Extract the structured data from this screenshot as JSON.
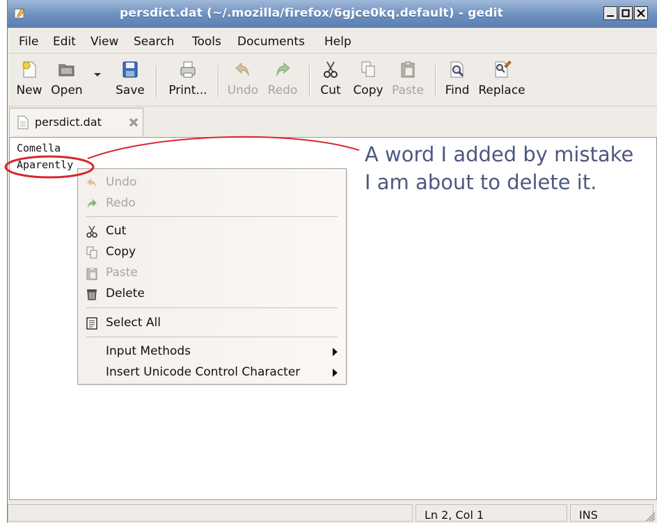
{
  "window": {
    "title": "persdict.dat (~/.mozilla/firefox/6gjce0kq.default) - gedit"
  },
  "menubar": {
    "items": [
      "File",
      "Edit",
      "View",
      "Search",
      "Tools",
      "Documents",
      "Help"
    ]
  },
  "toolbar": {
    "new": "New",
    "open": "Open",
    "save": "Save",
    "print": "Print...",
    "undo": "Undo",
    "redo": "Redo",
    "cut": "Cut",
    "copy": "Copy",
    "paste": "Paste",
    "find": "Find",
    "replace": "Replace"
  },
  "tab": {
    "label": "persdict.dat"
  },
  "editor": {
    "lines": [
      "Comella",
      "Aparently"
    ]
  },
  "context_menu": {
    "undo": "Undo",
    "redo": "Redo",
    "cut": "Cut",
    "copy": "Copy",
    "paste": "Paste",
    "delete": "Delete",
    "select_all": "Select All",
    "input_methods": "Input Methods",
    "insert_unicode": "Insert Unicode Control Character"
  },
  "annotation": {
    "line1": "A word I added by mistake",
    "line2": "I am about to delete it."
  },
  "statusbar": {
    "position": "Ln 2, Col 1",
    "mode": "INS"
  },
  "colors": {
    "titlebar": "#6c8fbf",
    "annotation_circle": "#d8262d",
    "annotation_text": "#4f5780"
  }
}
